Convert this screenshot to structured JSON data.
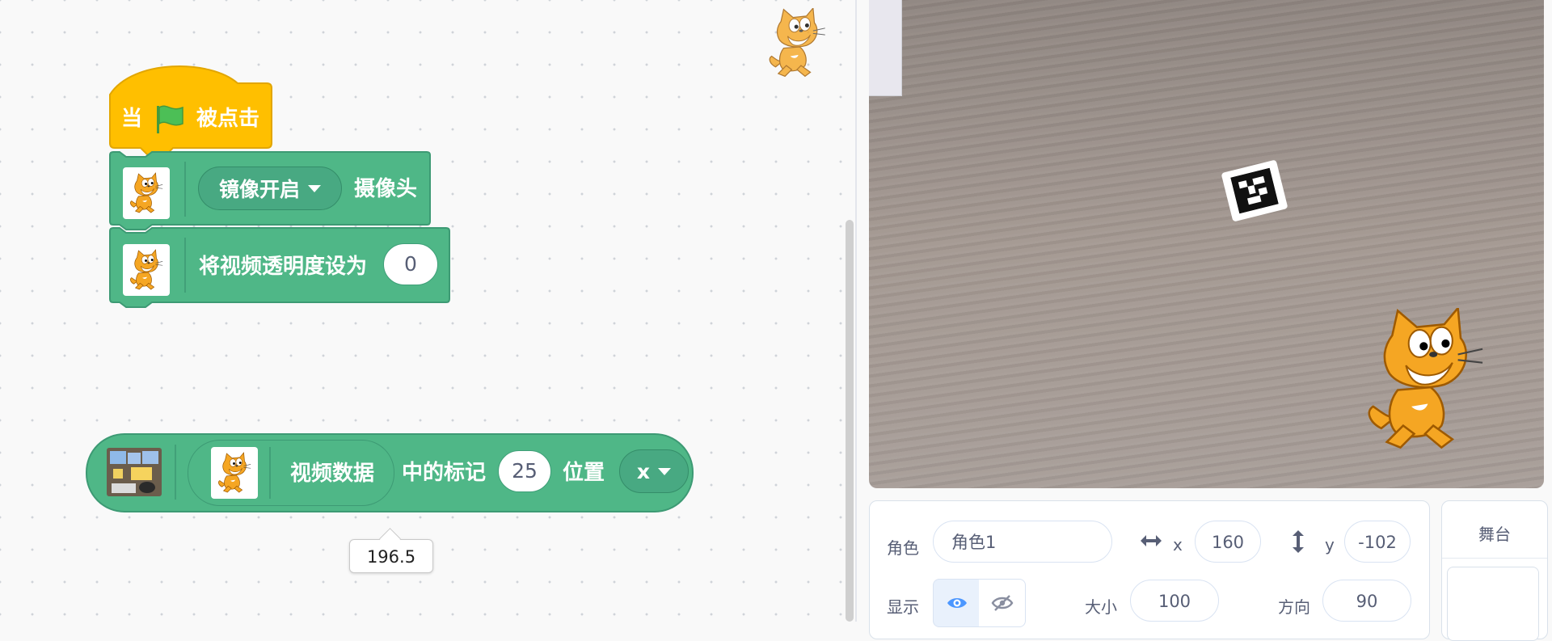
{
  "script": {
    "hat": {
      "prefix": "当",
      "suffix": "被点击",
      "flag_icon": "green-flag-icon"
    },
    "mirror_block": {
      "dropdown_value": "镜像开启",
      "suffix": "摄像头"
    },
    "transparency_block": {
      "label": "将视频透明度设为",
      "value": "0"
    }
  },
  "reporter": {
    "inner_label": "视频数据",
    "middle_label": "中的标记",
    "marker_id": "25",
    "position_label": "位置",
    "axis_value": "x",
    "result_bubble": "196.5"
  },
  "sprite_info": {
    "sprite_label": "角色",
    "sprite_name": "角色1",
    "x_label": "x",
    "x_value": "160",
    "y_label": "y",
    "y_value": "-102",
    "show_label": "显示",
    "size_label": "大小",
    "size_value": "100",
    "direction_label": "方向",
    "direction_value": "90"
  },
  "stage_panel": {
    "title": "舞台"
  },
  "colors": {
    "event_yellow": "#ffbf00",
    "extension_green": "#4fb787",
    "eye_blue": "#4c97ff"
  }
}
